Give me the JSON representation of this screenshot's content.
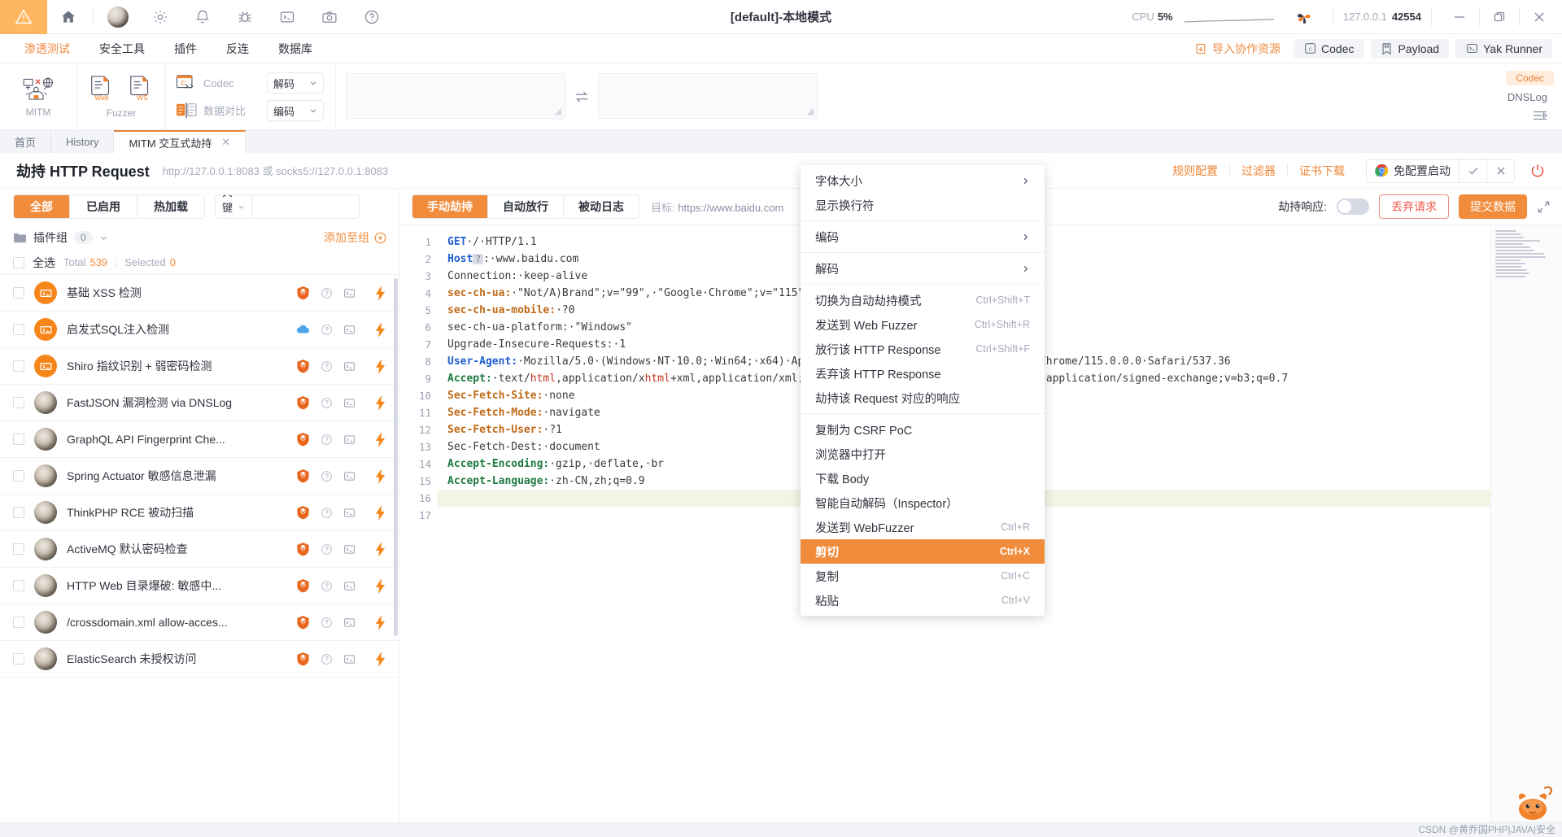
{
  "titlebar": {
    "warning_icon": "warning-triangle-icon",
    "icons": [
      "home-icon",
      "avatar-icon",
      "gear-icon",
      "bell-icon",
      "bug-icon",
      "terminal-icon",
      "camera-icon",
      "help-icon"
    ],
    "title": "[default]-本地模式",
    "cpu_label": "CPU",
    "cpu_value": "5%",
    "logo": "yak-logo-icon",
    "address_host": "127.0.0.1",
    "address_port": "42554",
    "minimize": "−",
    "maximize": "maximize-icon",
    "close": "×"
  },
  "menubar": {
    "items": [
      {
        "label": "渗透测试",
        "active": true
      },
      {
        "label": "安全工具",
        "active": false
      },
      {
        "label": "插件",
        "active": false
      },
      {
        "label": "反连",
        "active": false
      },
      {
        "label": "数据库",
        "active": false
      }
    ],
    "import_label": "导入协作资源",
    "buttons": [
      {
        "label": "Codec",
        "icon": "codec-icon"
      },
      {
        "label": "Payload",
        "icon": "payload-book-icon"
      },
      {
        "label": "Yak Runner",
        "icon": "yak-runner-icon"
      }
    ]
  },
  "ribbon": {
    "tools": [
      {
        "label": "MITM",
        "icon": "mitm-icon"
      },
      {
        "label": "Fuzzer",
        "icon": "fuzzer-icon"
      }
    ],
    "fuzzer_sub": [
      "Web",
      "WS"
    ],
    "codec_label": "Codec",
    "datacmp_label": "数据对比",
    "select_decode": "解码",
    "select_encode": "编码",
    "right_tags": [
      "Codec",
      "DNSLog"
    ]
  },
  "tabs": [
    {
      "label": "首页",
      "active": false,
      "closable": false
    },
    {
      "label": "History",
      "active": false,
      "closable": false
    },
    {
      "label": "MITM 交互式劫持",
      "active": true,
      "closable": true
    }
  ],
  "subheader": {
    "title_cn": "劫持",
    "title_en": "HTTP Request",
    "url": "http://127.0.0.1:8083 或 socks5://127.0.0.1:8083",
    "links": [
      "规则配置",
      "过滤器",
      "证书下载"
    ],
    "launch_label": "免配置启动",
    "launch_icon": "chrome-icon",
    "check_icon": "check-icon",
    "cancel_icon": "close-icon",
    "power_icon": "power-icon"
  },
  "left_panel": {
    "segments": [
      {
        "label": "全部",
        "active": true
      },
      {
        "label": "已启用",
        "active": false
      },
      {
        "label": "热加载",
        "active": false
      }
    ],
    "search_select": "关键字",
    "search_value": "",
    "search_placeholder": "",
    "search_icon": "search-icon",
    "group_label": "插件组",
    "group_count": "0",
    "add_to_group": "添加至组",
    "add_icon": "plus-circle-icon",
    "select_all": "全选",
    "total_label": "Total",
    "total_value": "539",
    "selected_label": "Selected",
    "selected_value": "0",
    "plugins": [
      {
        "name": "基础 XSS 检测",
        "avatar": "term",
        "badge": "shield-icon"
      },
      {
        "name": "启发式SQL注入检测",
        "avatar": "term",
        "badge": "cloud-icon"
      },
      {
        "name": "Shiro 指纹识别 + 弱密码检测",
        "avatar": "term",
        "badge": "shield-icon"
      },
      {
        "name": "FastJSON 漏洞检测 via DNSLog",
        "avatar": "photo",
        "badge": "shield-icon"
      },
      {
        "name": "GraphQL API Fingerprint Che...",
        "avatar": "photo",
        "badge": "shield-icon"
      },
      {
        "name": "Spring Actuator 敏感信息泄漏",
        "avatar": "photo",
        "badge": "shield-icon"
      },
      {
        "name": "ThinkPHP RCE 被动扫描",
        "avatar": "photo",
        "badge": "shield-icon"
      },
      {
        "name": "ActiveMQ 默认密码检查",
        "avatar": "photo",
        "badge": "shield-icon"
      },
      {
        "name": "HTTP Web 目录爆破: 敏感中...",
        "avatar": "photo",
        "badge": "shield-icon"
      },
      {
        "name": "/crossdomain.xml allow-acces...",
        "avatar": "photo",
        "badge": "shield-icon"
      },
      {
        "name": "ElasticSearch 未授权访问",
        "avatar": "photo",
        "badge": "shield-icon"
      }
    ]
  },
  "right_panel": {
    "segments": [
      {
        "label": "手动劫持",
        "active": true
      },
      {
        "label": "自动放行",
        "active": false
      },
      {
        "label": "被动日志",
        "active": false
      }
    ],
    "target_label": "目标:",
    "target_value": "https://www.baidu.com",
    "hijack_response_label": "劫持响应:",
    "hijack_response_on": false,
    "discard_label": "丢弃请求",
    "submit_label": "提交数据",
    "expand_icon": "expand-icon"
  },
  "editor": {
    "line_numbers": [
      "1",
      "2",
      "3",
      "4",
      "5",
      "6",
      "7",
      "8",
      "9",
      "10",
      "11",
      "12",
      "13",
      "14",
      "15",
      "16",
      "17"
    ],
    "current_line": 16,
    "lines": [
      {
        "n": 1,
        "segments": [
          {
            "t": "GET",
            "c": "k-blue"
          },
          {
            "t": "·/·HTTP/1.1",
            "c": "k-plain"
          }
        ]
      },
      {
        "n": 2,
        "segments": [
          {
            "t": "Host",
            "c": "k-blue"
          },
          {
            "t": " ? ",
            "c": "badge"
          },
          {
            "t": ":·www.baidu.com",
            "c": "k-plain"
          }
        ]
      },
      {
        "n": 3,
        "segments": [
          {
            "t": "Connection:·keep-alive",
            "c": "k-plain"
          }
        ]
      },
      {
        "n": 4,
        "segments": [
          {
            "t": "sec-ch-ua:",
            "c": "k-orange"
          },
          {
            "t": "·\"Not/A)Brand\";v=\"99\",·\"Google·Chrome\";v=\"115\",·\"Chromium\";v=\"115\"",
            "c": "k-plain"
          }
        ]
      },
      {
        "n": 5,
        "segments": [
          {
            "t": "sec-ch-ua-mobile:",
            "c": "k-orange"
          },
          {
            "t": "·?0",
            "c": "k-plain"
          }
        ]
      },
      {
        "n": 6,
        "segments": [
          {
            "t": "sec-ch-ua-platform:·\"Windows\"",
            "c": "k-plain"
          }
        ]
      },
      {
        "n": 7,
        "segments": [
          {
            "t": "Upgrade-Insecure-Requests:·1",
            "c": "k-plain"
          }
        ]
      },
      {
        "n": 8,
        "segments": [
          {
            "t": "User-Agent:",
            "c": "k-blue"
          },
          {
            "t": "·Mozilla/5.0·(Windows·NT·10.0;·Win64;·x64)·AppleWebKit/537.36·(KHTML,·like·Gecko)·Chrome/115.0.0.0·Safari/537.36",
            "c": "k-plain"
          }
        ]
      },
      {
        "n": 9,
        "segments": [
          {
            "t": "Accept:",
            "c": "k-green"
          },
          {
            "t": "·text/",
            "c": "k-plain"
          },
          {
            "t": "html",
            "c": "k-red"
          },
          {
            "t": ",application/x",
            "c": "k-plain"
          },
          {
            "t": "html",
            "c": "k-red"
          },
          {
            "t": "+xml,application/xml;q=0.9,image/webp,image/apng,*/*;q=0.8,application/signed-exchange;v=b3;q=0.7",
            "c": "k-plain"
          }
        ]
      },
      {
        "n": 10,
        "segments": [
          {
            "t": "Sec-Fetch-Site:",
            "c": "k-orange"
          },
          {
            "t": "·none",
            "c": "k-plain"
          }
        ]
      },
      {
        "n": 11,
        "segments": [
          {
            "t": "Sec-Fetch-Mode:",
            "c": "k-orange"
          },
          {
            "t": "·navigate",
            "c": "k-plain"
          }
        ]
      },
      {
        "n": 12,
        "segments": [
          {
            "t": "Sec-Fetch-User:",
            "c": "k-orange"
          },
          {
            "t": "·?1",
            "c": "k-plain"
          }
        ]
      },
      {
        "n": 13,
        "segments": [
          {
            "t": "Sec-Fetch-Dest:·document",
            "c": "k-plain"
          }
        ]
      },
      {
        "n": 14,
        "segments": [
          {
            "t": "Accept-Encoding:",
            "c": "k-green"
          },
          {
            "t": "·gzip,·deflate,·br",
            "c": "k-plain"
          }
        ]
      },
      {
        "n": 15,
        "segments": [
          {
            "t": "Accept-Language:",
            "c": "k-green"
          },
          {
            "t": "·zh-CN,zh;q=0.9",
            "c": "k-plain"
          }
        ]
      },
      {
        "n": 16,
        "segments": [
          {
            "t": "",
            "c": "k-plain"
          }
        ]
      },
      {
        "n": 17,
        "segments": [
          {
            "t": "",
            "c": "k-plain"
          }
        ]
      }
    ]
  },
  "context_menu": {
    "items": [
      {
        "label": "字体大小",
        "arrow": true
      },
      {
        "label": "显示换行符"
      },
      {
        "sep": true
      },
      {
        "label": "编码",
        "arrow": true
      },
      {
        "sep": true
      },
      {
        "label": "解码",
        "arrow": true
      },
      {
        "sep": true
      },
      {
        "label": "切换为自动劫持模式",
        "key": "Ctrl+Shift+T"
      },
      {
        "label": "发送到 Web Fuzzer",
        "key": "Ctrl+Shift+R"
      },
      {
        "label": "放行该 HTTP Response",
        "key": "Ctrl+Shift+F"
      },
      {
        "label": "丢弃该 HTTP Response"
      },
      {
        "label": "劫持该 Request 对应的响应"
      },
      {
        "sep": true
      },
      {
        "label": "复制为 CSRF PoC"
      },
      {
        "label": "浏览器中打开"
      },
      {
        "label": "下载 Body"
      },
      {
        "label": "智能自动解码（Inspector）"
      },
      {
        "label": "发送到 WebFuzzer",
        "key": "Ctrl+R"
      },
      {
        "label": "剪切",
        "key": "Ctrl+X",
        "highlighted": true
      },
      {
        "label": "复制",
        "key": "Ctrl+C"
      },
      {
        "label": "粘贴",
        "key": "Ctrl+V"
      }
    ]
  },
  "footer": {
    "watermark": "CSDN @黄乔国PHP|JAVA|安全"
  },
  "colors": {
    "accent": "#f08c3c",
    "accent_light": "#ffb660",
    "danger": "#ef4b41",
    "text": "#31343f",
    "muted": "#a6aabb"
  }
}
